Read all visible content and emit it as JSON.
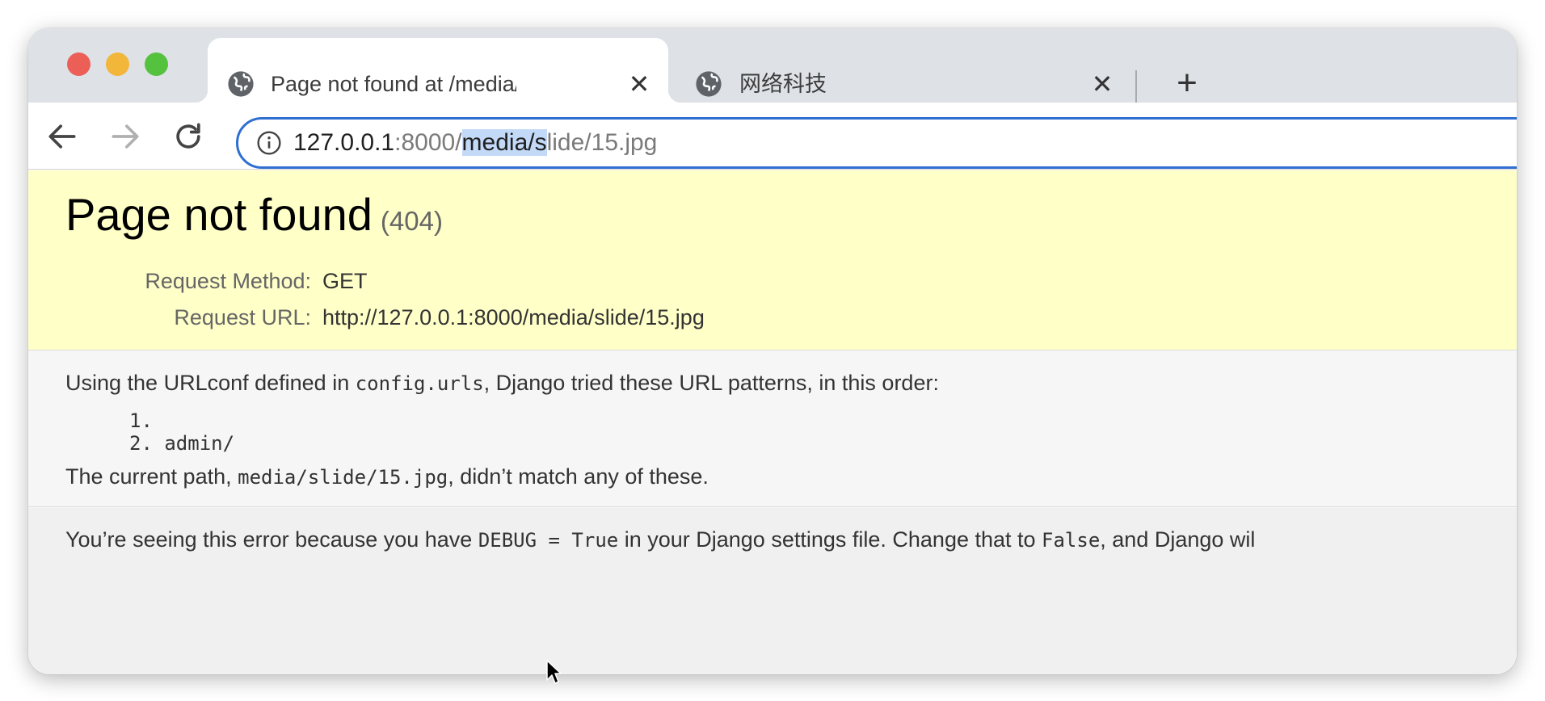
{
  "browser": {
    "tabs": [
      {
        "title": "Page not found at /media/slide/",
        "active": true,
        "icon": "globe-icon"
      },
      {
        "title": "网络科技",
        "active": false,
        "icon": "globe-icon"
      }
    ],
    "new_tab_label": "+",
    "close_label": "✕",
    "address_bar": {
      "host": "127.0.0.1",
      "port_path_before": ":8000/",
      "selected": "media/s",
      "path_after": "lide/15.jpg",
      "icon": "info-icon"
    }
  },
  "page": {
    "title": "Page not found",
    "status_code": "(404)",
    "request": {
      "method_label": "Request Method:",
      "method_value": "GET",
      "url_label": "Request URL:",
      "url_value": "http://127.0.0.1:8000/media/slide/15.jpg"
    },
    "urlconf_text": {
      "before": "Using the URLconf defined in ",
      "module": "config.urls",
      "after": ", Django tried these URL patterns, in this order:"
    },
    "patterns": [
      "1. ",
      "2. admin/"
    ],
    "current_path_text": {
      "before": "The current path, ",
      "path": "media/slide/15.jpg",
      "after": ", didn’t match any of these."
    },
    "debug_text": {
      "before": "You’re seeing this error because you have ",
      "setting": "DEBUG = True",
      "middle": " in your Django settings file. Change that to ",
      "value": "False",
      "after": ", and Django wil"
    }
  },
  "colors": {
    "summary_bg": "#ffffc8",
    "focus_ring": "#2f6fd2",
    "selection": "#c3d9f8"
  }
}
